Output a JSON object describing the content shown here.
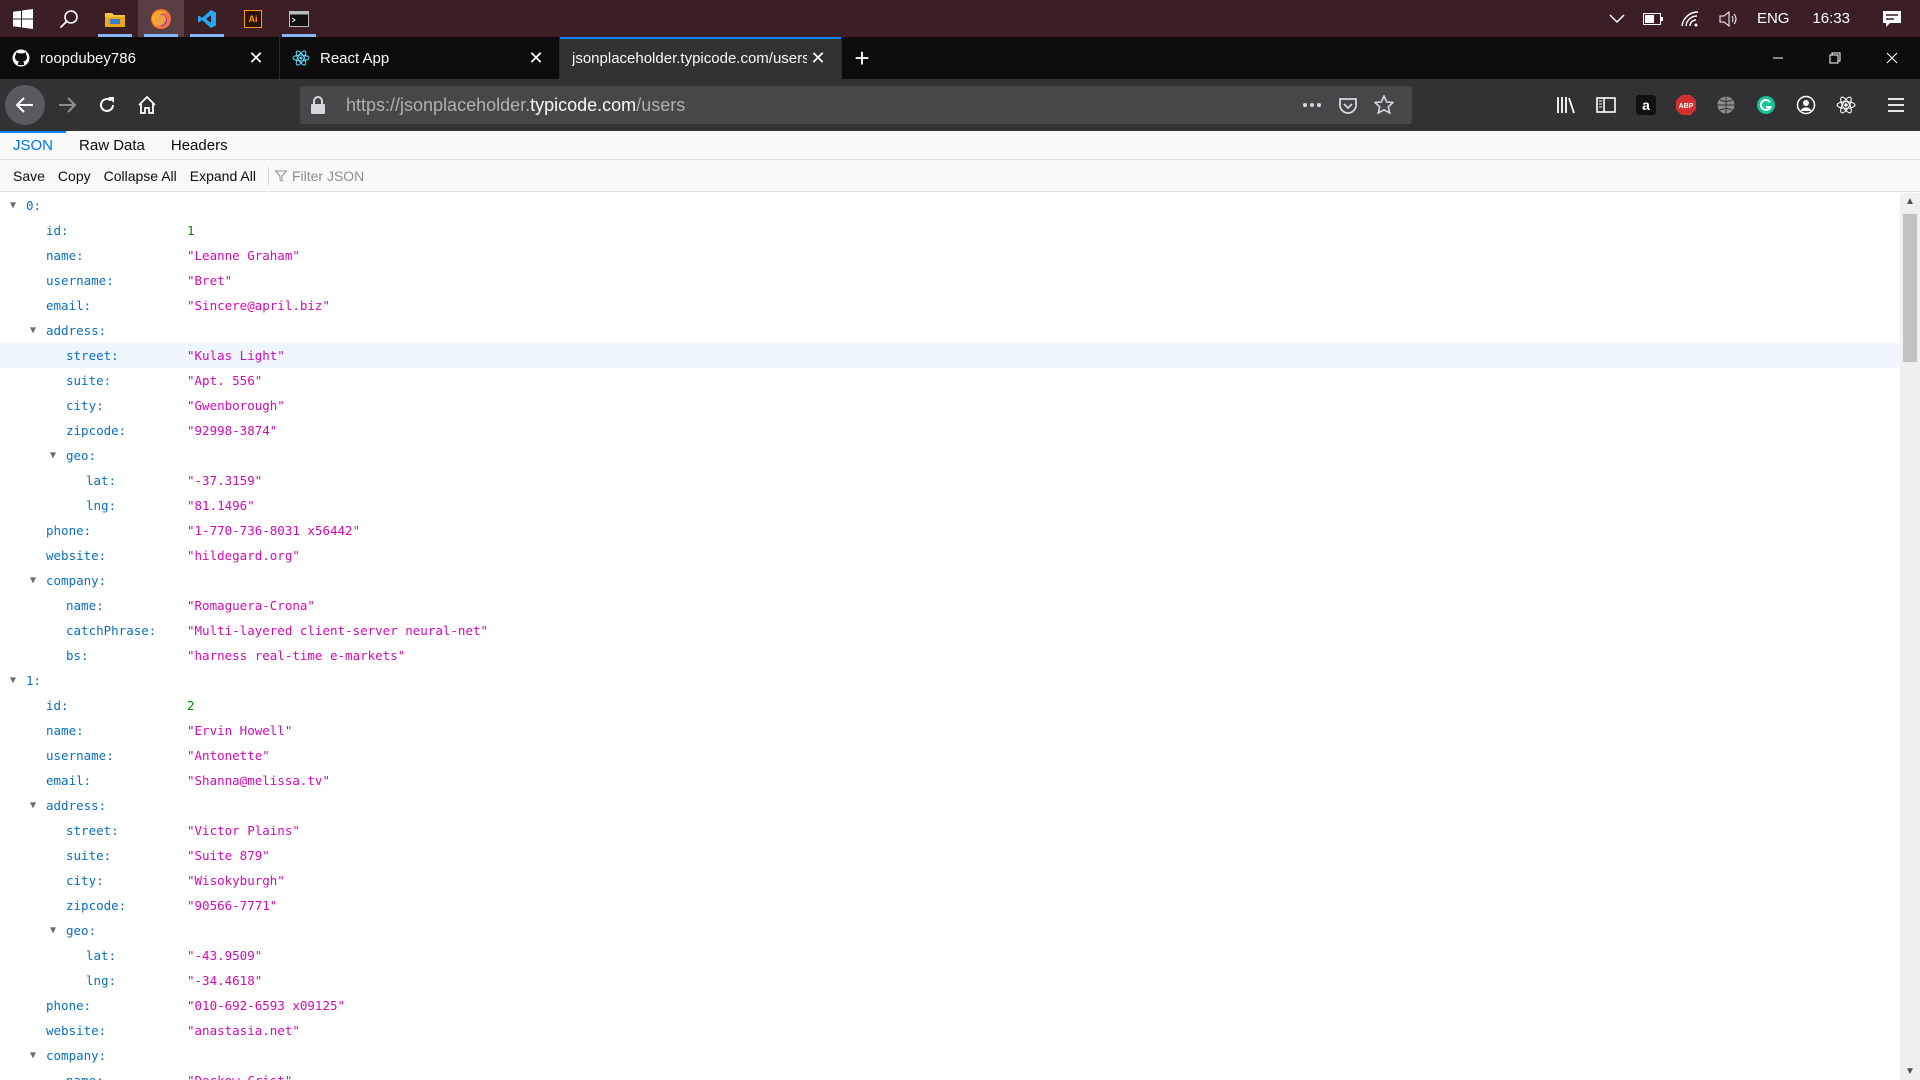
{
  "taskbar": {
    "apps": [
      {
        "name": "start",
        "icon": "windows-logo-icon"
      },
      {
        "name": "search",
        "icon": "search-icon"
      },
      {
        "name": "file-explorer",
        "icon": "folder-icon"
      },
      {
        "name": "firefox",
        "icon": "firefox-icon"
      },
      {
        "name": "vscode",
        "icon": "vscode-icon"
      },
      {
        "name": "illustrator",
        "icon": "illustrator-icon",
        "label": "Ai"
      },
      {
        "name": "terminal",
        "icon": "terminal-icon"
      }
    ],
    "language": "ENG",
    "clock": "16:33"
  },
  "tabs": [
    {
      "title": "roopdubey786",
      "icon": "github-icon"
    },
    {
      "title": "React App",
      "icon": "react-icon"
    },
    {
      "title": "jsonplaceholder.typicode.com/users",
      "icon": "none",
      "selected": true
    }
  ],
  "urlbar": {
    "prefix": "https://jsonplaceholder.",
    "domain": "typicode.com",
    "path": "/users"
  },
  "viewer": {
    "tabs": [
      "JSON",
      "Raw Data",
      "Headers"
    ],
    "toolbar": {
      "save": "Save",
      "copy": "Copy",
      "collapse_all": "Collapse All",
      "expand_all": "Expand All",
      "filter_placeholder": "Filter JSON"
    }
  },
  "json_rows": [
    {
      "depth": 0,
      "key": "0:",
      "expandable": true
    },
    {
      "depth": 1,
      "key": "id:",
      "value": "1",
      "type": "num"
    },
    {
      "depth": 1,
      "key": "name:",
      "value": "\"Leanne Graham\"",
      "type": "str"
    },
    {
      "depth": 1,
      "key": "username:",
      "value": "\"Bret\"",
      "type": "str"
    },
    {
      "depth": 1,
      "key": "email:",
      "value": "\"Sincere@april.biz\"",
      "type": "str"
    },
    {
      "depth": 1,
      "key": "address:",
      "expandable": true
    },
    {
      "depth": 2,
      "key": "street:",
      "value": "\"Kulas Light\"",
      "type": "str",
      "highlight": true
    },
    {
      "depth": 2,
      "key": "suite:",
      "value": "\"Apt. 556\"",
      "type": "str"
    },
    {
      "depth": 2,
      "key": "city:",
      "value": "\"Gwenborough\"",
      "type": "str"
    },
    {
      "depth": 2,
      "key": "zipcode:",
      "value": "\"92998-3874\"",
      "type": "str"
    },
    {
      "depth": 2,
      "key": "geo:",
      "expandable": true
    },
    {
      "depth": 3,
      "key": "lat:",
      "value": "\"-37.3159\"",
      "type": "str"
    },
    {
      "depth": 3,
      "key": "lng:",
      "value": "\"81.1496\"",
      "type": "str"
    },
    {
      "depth": 1,
      "key": "phone:",
      "value": "\"1-770-736-8031 x56442\"",
      "type": "str"
    },
    {
      "depth": 1,
      "key": "website:",
      "value": "\"hildegard.org\"",
      "type": "str"
    },
    {
      "depth": 1,
      "key": "company:",
      "expandable": true
    },
    {
      "depth": 2,
      "key": "name:",
      "value": "\"Romaguera-Crona\"",
      "type": "str"
    },
    {
      "depth": 2,
      "key": "catchPhrase:",
      "value": "\"Multi-layered client-server neural-net\"",
      "type": "str"
    },
    {
      "depth": 2,
      "key": "bs:",
      "value": "\"harness real-time e-markets\"",
      "type": "str"
    },
    {
      "depth": 0,
      "key": "1:",
      "expandable": true
    },
    {
      "depth": 1,
      "key": "id:",
      "value": "2",
      "type": "num"
    },
    {
      "depth": 1,
      "key": "name:",
      "value": "\"Ervin Howell\"",
      "type": "str"
    },
    {
      "depth": 1,
      "key": "username:",
      "value": "\"Antonette\"",
      "type": "str"
    },
    {
      "depth": 1,
      "key": "email:",
      "value": "\"Shanna@melissa.tv\"",
      "type": "str"
    },
    {
      "depth": 1,
      "key": "address:",
      "expandable": true
    },
    {
      "depth": 2,
      "key": "street:",
      "value": "\"Victor Plains\"",
      "type": "str"
    },
    {
      "depth": 2,
      "key": "suite:",
      "value": "\"Suite 879\"",
      "type": "str"
    },
    {
      "depth": 2,
      "key": "city:",
      "value": "\"Wisokyburgh\"",
      "type": "str"
    },
    {
      "depth": 2,
      "key": "zipcode:",
      "value": "\"90566-7771\"",
      "type": "str"
    },
    {
      "depth": 2,
      "key": "geo:",
      "expandable": true
    },
    {
      "depth": 3,
      "key": "lat:",
      "value": "\"-43.9509\"",
      "type": "str"
    },
    {
      "depth": 3,
      "key": "lng:",
      "value": "\"-34.4618\"",
      "type": "str"
    },
    {
      "depth": 1,
      "key": "phone:",
      "value": "\"010-692-6593 x09125\"",
      "type": "str"
    },
    {
      "depth": 1,
      "key": "website:",
      "value": "\"anastasia.net\"",
      "type": "str"
    },
    {
      "depth": 1,
      "key": "company:",
      "expandable": true
    },
    {
      "depth": 2,
      "key": "name:",
      "value": "\"Deckow-Crist\"",
      "type": "str"
    }
  ],
  "colors": {
    "key": "#0b6fbf",
    "string": "#d10ab5",
    "number": "#058b00",
    "accent": "#0a84ff"
  }
}
